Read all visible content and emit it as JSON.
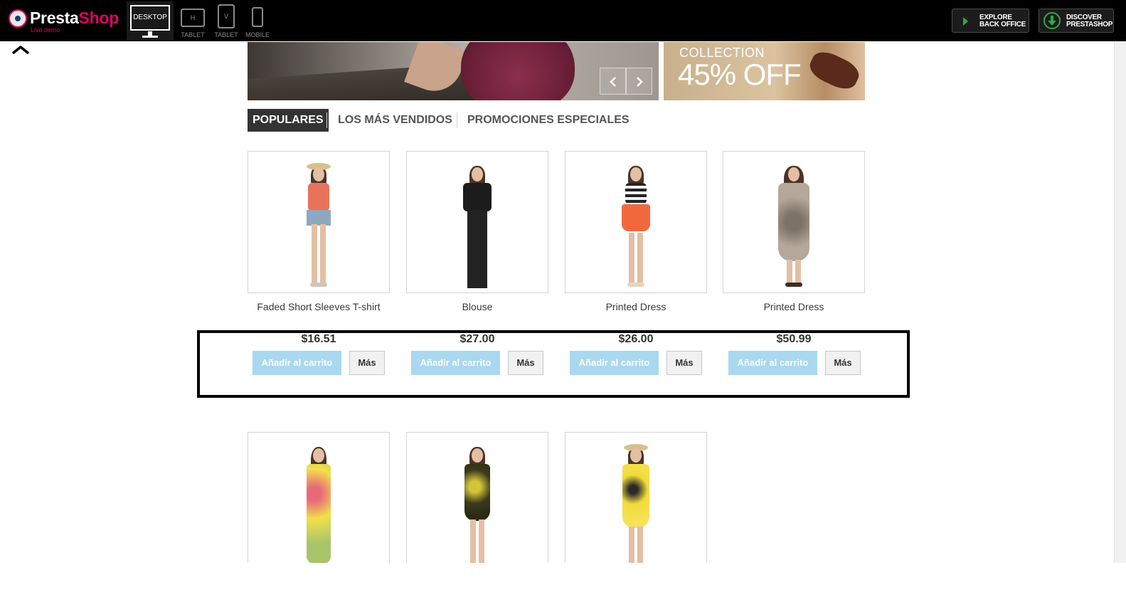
{
  "topbar": {
    "logo": {
      "name_part1": "Presta",
      "name_part2": "Shop",
      "subtitle": "Live demo"
    },
    "devices": [
      {
        "label": "DESKTOP"
      },
      {
        "label": "TABLET",
        "icon_text": "H"
      },
      {
        "label": "TABLET",
        "icon_text": "V"
      },
      {
        "label": "MOBILE"
      }
    ],
    "explore_button": "EXPLORE\nBACK OFFICE",
    "discover_button": "DISCOVER\nPRESTASHOP",
    "colors": {
      "brand": "#df0067",
      "accent_green": "#2fa846"
    }
  },
  "banner": {
    "right_collection": "COLLECTION",
    "right_discount": "45% OFF"
  },
  "tabs": [
    {
      "label": "POPULARES",
      "active": true
    },
    {
      "label": "LOS MÁS VENDIDOS",
      "active": false
    },
    {
      "label": "PROMOCIONES ESPECIALES",
      "active": false
    }
  ],
  "products": [
    {
      "name": "Faded Short Sleeves T-shirt",
      "price": "$16.51",
      "cart_label": "Añadir al carrito",
      "more_label": "Más"
    },
    {
      "name": "Blouse",
      "price": "$27.00",
      "cart_label": "Añadir al carrito",
      "more_label": "Más"
    },
    {
      "name": "Printed Dress",
      "price": "$26.00",
      "cart_label": "Añadir al carrito",
      "more_label": "Más"
    },
    {
      "name": "Printed Dress",
      "price": "$50.99",
      "cart_label": "Añadir al carrito",
      "more_label": "Más"
    }
  ],
  "second_row_images": [
    {
      "icon": "product-image-yellow-floral-dress"
    },
    {
      "icon": "product-image-dark-floral-dress"
    },
    {
      "icon": "product-image-yellow-summer-dress"
    }
  ],
  "button_colors": {
    "cart": "#a9d8ef",
    "more": "#f1f1f1"
  }
}
